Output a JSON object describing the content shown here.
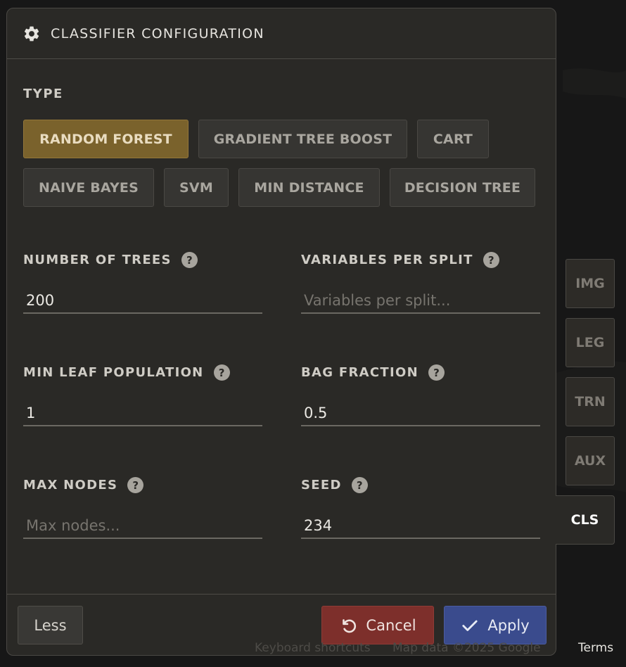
{
  "panel": {
    "title": "CLASSIFIER CONFIGURATION",
    "type_label": "TYPE",
    "classifier_types": [
      {
        "label": "RANDOM FOREST",
        "active": true
      },
      {
        "label": "GRADIENT TREE BOOST",
        "active": false
      },
      {
        "label": "CART",
        "active": false
      },
      {
        "label": "NAIVE BAYES",
        "active": false
      },
      {
        "label": "SVM",
        "active": false
      },
      {
        "label": "MIN DISTANCE",
        "active": false
      },
      {
        "label": "DECISION TREE",
        "active": false
      }
    ],
    "fields": {
      "number_of_trees": {
        "label": "NUMBER OF TREES",
        "value": "200",
        "placeholder": ""
      },
      "variables_per_split": {
        "label": "VARIABLES PER SPLIT",
        "value": "",
        "placeholder": "Variables per split..."
      },
      "min_leaf_population": {
        "label": "MIN LEAF POPULATION",
        "value": "1",
        "placeholder": ""
      },
      "bag_fraction": {
        "label": "BAG FRACTION",
        "value": "0.5",
        "placeholder": ""
      },
      "max_nodes": {
        "label": "MAX NODES",
        "value": "",
        "placeholder": "Max nodes..."
      },
      "seed": {
        "label": "SEED",
        "value": "234",
        "placeholder": ""
      }
    },
    "help_glyph": "?",
    "footer": {
      "less_label": "Less",
      "cancel_label": "Cancel",
      "apply_label": "Apply"
    }
  },
  "side_tabs": [
    {
      "label": "IMG",
      "active": false
    },
    {
      "label": "LEG",
      "active": false
    },
    {
      "label": "TRN",
      "active": false
    },
    {
      "label": "AUX",
      "active": false
    },
    {
      "label": "CLS",
      "active": true
    }
  ],
  "attribution": {
    "shortcuts": "Keyboard shortcuts",
    "map_data": "Map data ©2025 Google",
    "terms": "Terms"
  },
  "colors": {
    "accent_active": "#7a622c",
    "cancel": "#7d2f2b",
    "apply": "#3a4b8d"
  },
  "icons": {
    "header": "gear-icon",
    "cancel": "undo-icon",
    "apply": "check-icon",
    "help": "help-icon"
  }
}
